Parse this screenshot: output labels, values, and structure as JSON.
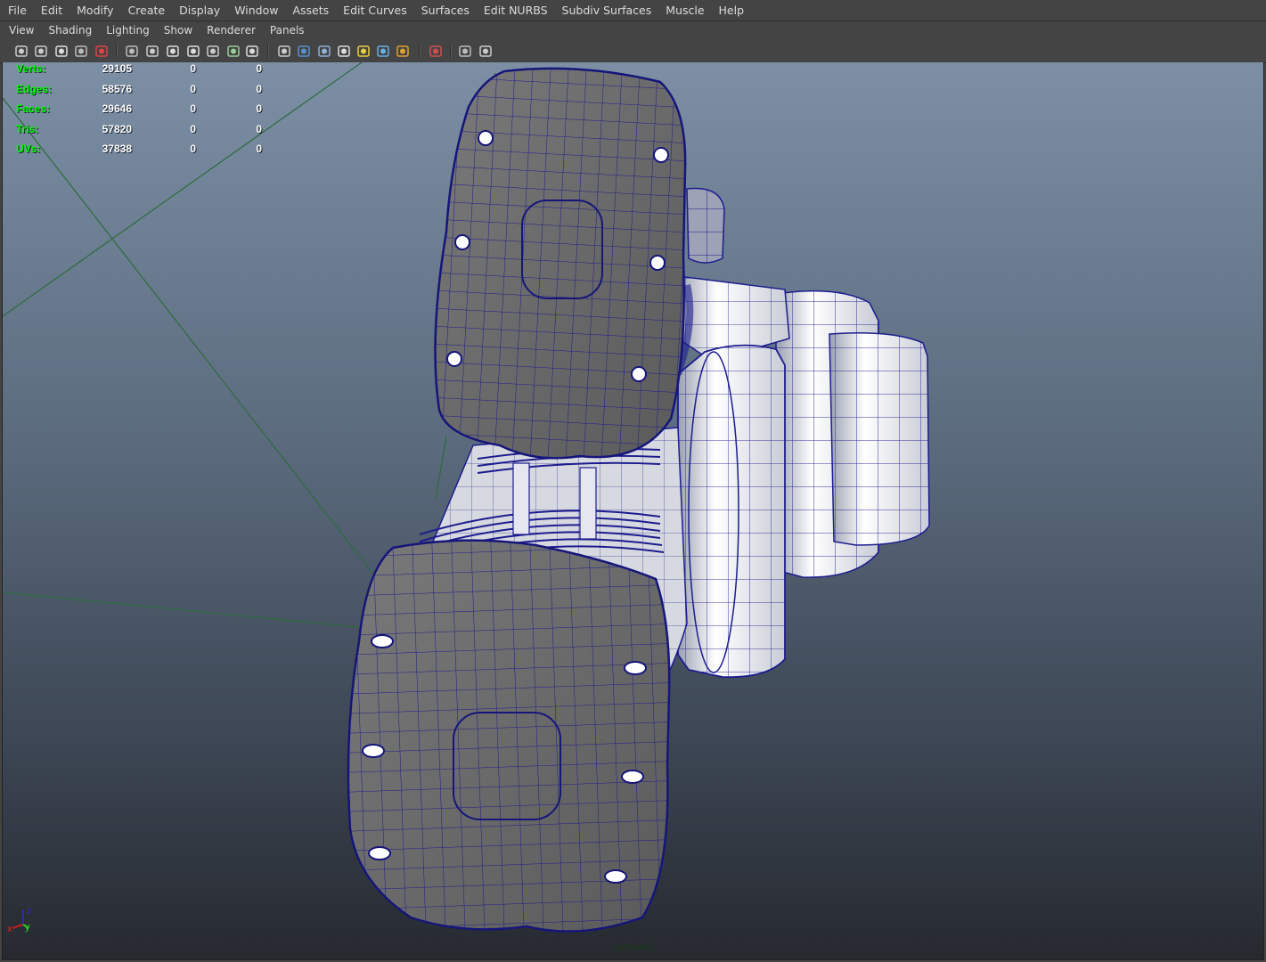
{
  "main_menu": [
    "File",
    "Edit",
    "Modify",
    "Create",
    "Display",
    "Window",
    "Assets",
    "Edit Curves",
    "Surfaces",
    "Edit NURBS",
    "Subdiv Surfaces",
    "Muscle",
    "Help"
  ],
  "panel_menu": [
    "View",
    "Shading",
    "Lighting",
    "Show",
    "Renderer",
    "Panels"
  ],
  "toolbar_icons": [
    "camera-select-icon",
    "camera-attributes-icon",
    "bookmark-icon",
    "image-plane-icon",
    "two-d-pan-icon",
    "grid-icon",
    "film-gate-icon",
    "resolution-gate-icon",
    "safe-action-icon",
    "field-chart-icon",
    "safe-title-icon",
    "wireframe-icon",
    "smooth-shade-icon",
    "wireframe-on-shaded-icon",
    "textured-icon",
    "use-all-lights-icon",
    "shadows-icon",
    "high-quality-icon",
    "isolate-select-icon",
    "xray-icon",
    "xray-joints-icon",
    "backface-icon"
  ],
  "hud": {
    "rows": [
      {
        "label": "Verts:",
        "v1": "29105",
        "v2": "0",
        "v3": "0"
      },
      {
        "label": "Edges:",
        "v1": "58576",
        "v2": "0",
        "v3": "0"
      },
      {
        "label": "Faces:",
        "v1": "29646",
        "v2": "0",
        "v3": "0"
      },
      {
        "label": "Tris:",
        "v1": "57820",
        "v2": "0",
        "v3": "0"
      },
      {
        "label": "UVs:",
        "v1": "37838",
        "v2": "0",
        "v3": "0"
      }
    ]
  },
  "camera_name": "camera1",
  "axis": {
    "x": "x",
    "y": "y",
    "z": "z"
  },
  "colors": {
    "hud_label": "#00ff00",
    "hud_value": "#ffffff",
    "wire": "#1a1a8c",
    "mesh_gray": "#6f6f6f",
    "grid_line": "#2e6b3c"
  }
}
